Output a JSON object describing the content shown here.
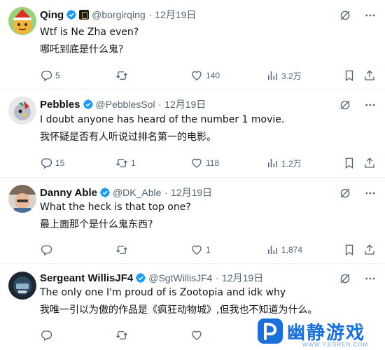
{
  "posts": [
    {
      "name": "Qing",
      "handle": "@borgirqing",
      "dot": "·",
      "date": "12月19日",
      "text_en": "Wtf is Ne Zha even?",
      "text_zh": "哪吒到底是什么鬼?",
      "replies": "5",
      "reposts": "",
      "likes": "140",
      "views": "3.2万"
    },
    {
      "name": "Pebbles",
      "handle": "@PebblesSol",
      "dot": "·",
      "date": "12月19日",
      "text_en": "I doubt anyone has heard of the number 1 movie.",
      "text_zh": "我怀疑是否有人听说过排名第一的电影。",
      "replies": "15",
      "reposts": "1",
      "likes": "118",
      "views": "1.2万"
    },
    {
      "name": "Danny Able",
      "handle": "@DK_Able",
      "dot": "·",
      "date": "12月19日",
      "text_en": "What the heck is that top one?",
      "text_zh": "最上面那个是什么鬼东西?",
      "replies": "",
      "reposts": "",
      "likes": "1",
      "views": "1,874"
    },
    {
      "name": "Sergeant WillisJF4",
      "handle": "@SgtWillisJF4",
      "dot": "·",
      "date": "12月19日",
      "text_en": "The only one I'm proud of is Zootopia and idk why",
      "text_zh": "我唯一引以为傲的作品是《疯狂动物城》,但我也不知道为什么。",
      "replies": "",
      "reposts": "",
      "likes": "",
      "views": ""
    }
  ],
  "watermark": {
    "text": "幽静游戏",
    "url": "WWW.YJISREN.COM"
  },
  "colors": {
    "verified": "#1d9bf0",
    "muted": "#536471",
    "text": "#0f1419",
    "divider": "#eff3f4",
    "watermark": "#1a6fd8"
  },
  "icons": [
    "verified-icon",
    "grok-icon",
    "more-icon",
    "reply-icon",
    "repost-icon",
    "like-icon",
    "views-icon",
    "bookmark-icon",
    "share-icon"
  ]
}
